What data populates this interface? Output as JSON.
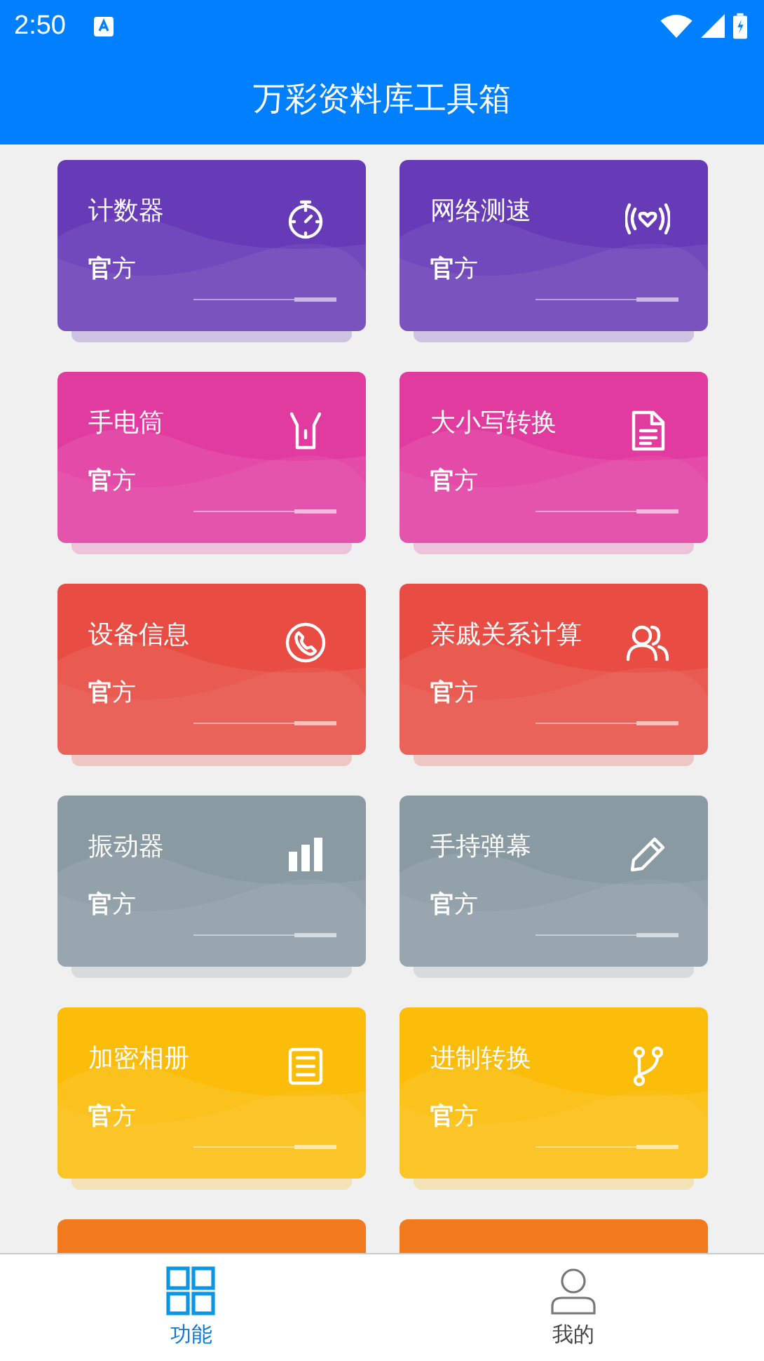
{
  "status_bar": {
    "time": "2:50"
  },
  "header": {
    "title": "万彩资料库工具箱"
  },
  "tools": [
    {
      "name": "计数器",
      "badge": "**官**方",
      "color": "#673ab7"
    },
    {
      "name": "网络测速",
      "badge": "**官**方",
      "color": "#673ab7"
    },
    {
      "name": "手电筒",
      "badge": "**官**方",
      "color": "#e23ba0"
    },
    {
      "name": "大小写转换",
      "badge": "**官**方",
      "color": "#e23ba0"
    },
    {
      "name": "设备信息",
      "badge": "**官**方",
      "color": "#e84c43"
    },
    {
      "name": "亲戚关系计算",
      "badge": "**官**方",
      "color": "#e84c43"
    },
    {
      "name": "振动器",
      "badge": "**官**方",
      "color": "#8a9aa3"
    },
    {
      "name": "手持弹幕",
      "badge": "**官**方",
      "color": "#8a9aa3"
    },
    {
      "name": "加密相册",
      "badge": "**官**方",
      "color": "#fbbd0a"
    },
    {
      "name": "进制转换",
      "badge": "**官**方",
      "color": "#fbbd0a"
    },
    {
      "color": "#f27a1e"
    },
    {
      "color": "#f27a1e"
    }
  ],
  "nav": [
    {
      "label": "功能",
      "selected": true
    },
    {
      "label": "我的",
      "selected": false
    }
  ]
}
